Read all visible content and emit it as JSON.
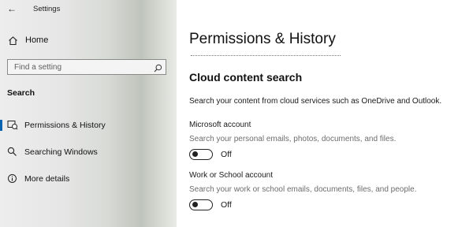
{
  "app": {
    "title": "Settings"
  },
  "sidebar": {
    "home_label": "Home",
    "search_placeholder": "Find a setting",
    "section_heading": "Search",
    "items": [
      {
        "label": "Permissions & History",
        "icon": "permissions-icon",
        "selected": true
      },
      {
        "label": "Searching Windows",
        "icon": "search-icon",
        "selected": false
      },
      {
        "label": "More details",
        "icon": "info-icon",
        "selected": false
      }
    ]
  },
  "main": {
    "page_title": "Permissions & History",
    "section_title": "Cloud content search",
    "description": "Search your content from cloud services such as OneDrive and Outlook.",
    "settings": [
      {
        "name": "Microsoft account",
        "description": "Search your personal emails, photos, documents, and files.",
        "state": "Off"
      },
      {
        "name": "Work or School account",
        "description": "Search your work or school emails, documents, files, and people.",
        "state": "Off"
      }
    ]
  },
  "colors": {
    "accent": "#0063b1",
    "secondary_text": "#6d6d6d"
  }
}
